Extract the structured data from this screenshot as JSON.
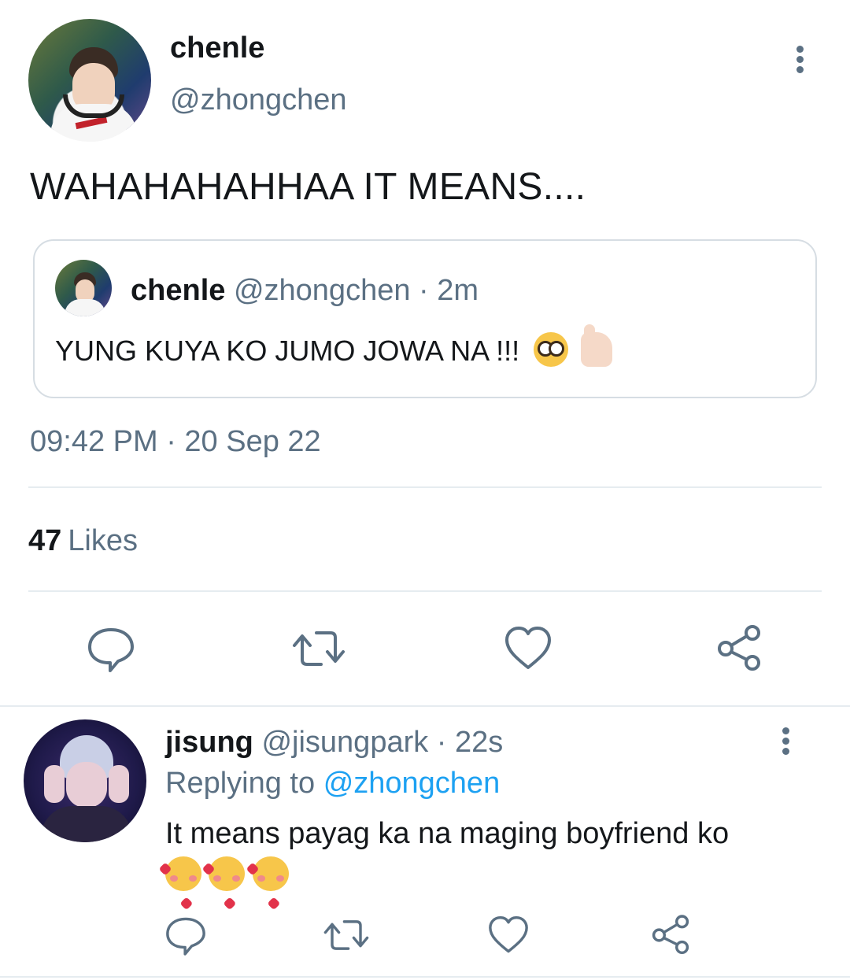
{
  "main_tweet": {
    "name": "chenle",
    "handle": "@zhongchen",
    "text": "WAHAHAHAHHAA IT MEANS....",
    "quote": {
      "name": "chenle",
      "meta": "@zhongchen · 2m",
      "text": "YUNG KUYA KO JUMO JOWA NA !!!",
      "emojis": [
        "nerd-face",
        "thumbs-up"
      ]
    },
    "timestamp": "09:42 PM · 20 Sep 22",
    "likes_count": "47",
    "likes_label": "Likes",
    "actions": [
      "reply-icon",
      "retweet-icon",
      "like-icon",
      "share-icon"
    ]
  },
  "reply": {
    "name": "jisung",
    "meta": "@jisungpark · 22s",
    "replying_label": "Replying to",
    "replying_to": "@zhongchen",
    "text": "It means payag ka na maging boyfriend ko",
    "emojis": [
      "smiling-face-with-hearts",
      "smiling-face-with-hearts",
      "smiling-face-with-hearts"
    ],
    "actions": [
      "reply-icon",
      "retweet-icon",
      "like-icon",
      "share-icon"
    ]
  },
  "colors": {
    "text": "#14171a",
    "secondary": "#5b7083",
    "link": "#1da1f2",
    "divider": "#e6ecf0"
  }
}
